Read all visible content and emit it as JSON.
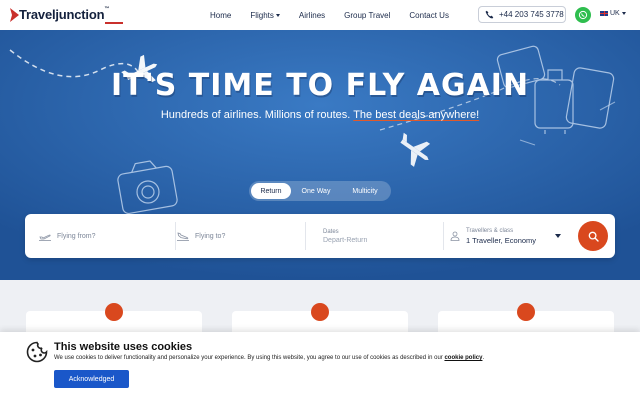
{
  "header": {
    "logo_text": "Traveljunction",
    "logo_tm": "™",
    "nav": [
      "Home",
      "Flights",
      "Airlines",
      "Group Travel",
      "Contact Us"
    ],
    "phone": "+44 203 745 3778",
    "locale": "UK"
  },
  "hero": {
    "title": "IT'S TIME TO FLY AGAIN",
    "subtitle_plain": "Hundreds of airlines. Millions of routes.",
    "subtitle_highlight": "The best deals anywhere!",
    "tabs": [
      "Return",
      "One Way",
      "Multicity"
    ],
    "active_tab": "Return"
  },
  "search": {
    "from_placeholder": "Flying from?",
    "to_placeholder": "Flying to?",
    "dates_label": "Dates",
    "dates_placeholder": "Depart-Return",
    "travellers_label": "Travellers & class",
    "travellers_value": "1 Traveller, Economy"
  },
  "cookie": {
    "title": "This website uses cookies",
    "text": "We use cookies to deliver functionality and personalize your experience. By using this website, you agree to our use of cookies as described in our",
    "link": "cookie policy",
    "text_end": ".",
    "button": "Acknowledged"
  },
  "colors": {
    "brand_blue": "#2a63a8",
    "accent_orange": "#d9481e",
    "button_blue": "#1a57c9",
    "whatsapp_green": "#2fbe4f"
  },
  "icons": [
    "phone-icon",
    "whatsapp-icon",
    "flag-icon",
    "takeoff-icon",
    "landing-icon",
    "person-icon",
    "search-icon",
    "cookie-icon"
  ]
}
